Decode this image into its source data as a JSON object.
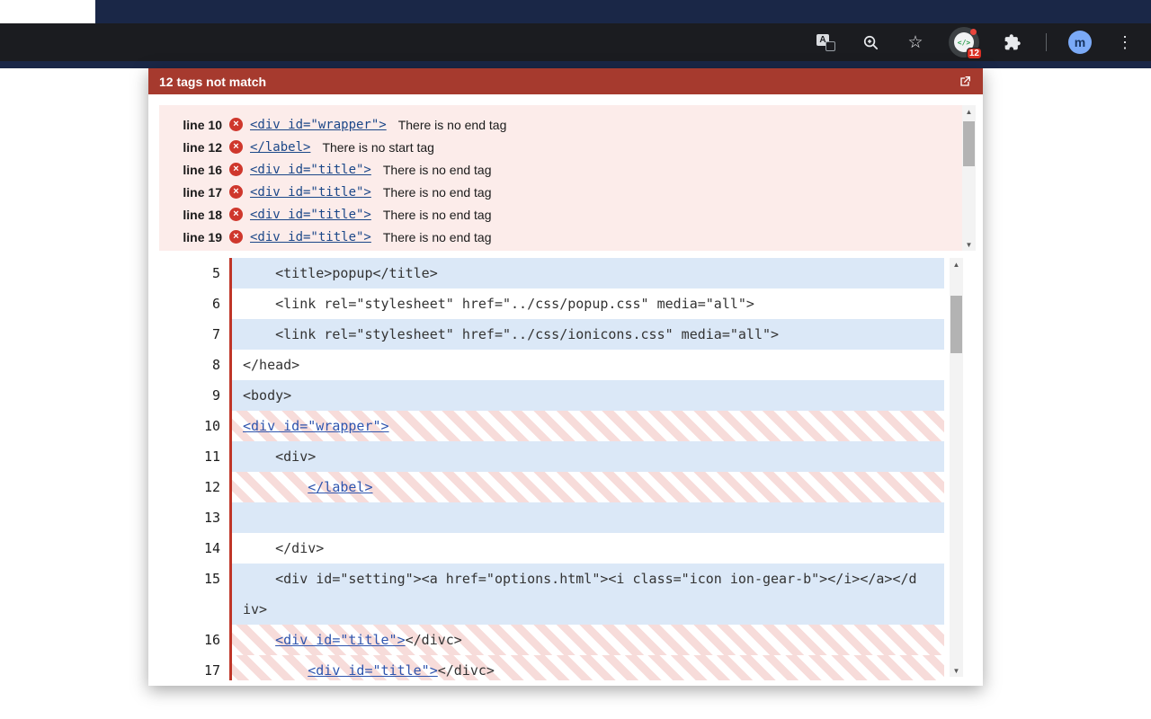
{
  "browser": {
    "avatar": "m",
    "extension_badge": "12",
    "extension_glyph": "</>",
    "translate_letter": "A",
    "star_glyph": "☆",
    "kebab_glyph": "⋮"
  },
  "popup": {
    "title": "12 tags not match",
    "errors": [
      {
        "line": "line 10",
        "tag": "<div id=\"wrapper\">",
        "message": "There is no end tag"
      },
      {
        "line": "line 12",
        "tag": "</label>",
        "message": "There is no start tag"
      },
      {
        "line": "line 16",
        "tag": "<div id=\"title\">",
        "message": "There is no end tag"
      },
      {
        "line": "line 17",
        "tag": "<div id=\"title\">",
        "message": "There is no end tag"
      },
      {
        "line": "line 18",
        "tag": "<div id=\"title\">",
        "message": "There is no end tag"
      },
      {
        "line": "line 19",
        "tag": "<div id=\"title\">",
        "message": "There is no end tag"
      }
    ],
    "code_lines": [
      {
        "num": "5",
        "bg": "blue",
        "segments": [
          {
            "text": "    <title>popup</title>"
          }
        ]
      },
      {
        "num": "6",
        "bg": "white",
        "segments": [
          {
            "text": "    <link rel=\"stylesheet\" href=\"../css/popup.css\" media=\"all\">"
          }
        ]
      },
      {
        "num": "7",
        "bg": "blue",
        "segments": [
          {
            "text": "    <link rel=\"stylesheet\" href=\"../css/ionicons.css\" media=\"all\">"
          }
        ]
      },
      {
        "num": "8",
        "bg": "white",
        "segments": [
          {
            "text": "</head>"
          }
        ]
      },
      {
        "num": "9",
        "bg": "blue",
        "segments": [
          {
            "text": "<body>"
          }
        ]
      },
      {
        "num": "10",
        "bg": "stripe",
        "segments": [
          {
            "text": "<div id=\"wrapper\">",
            "link": true
          }
        ]
      },
      {
        "num": "11",
        "bg": "blue",
        "segments": [
          {
            "text": "    <div>"
          }
        ]
      },
      {
        "num": "12",
        "bg": "stripe",
        "segments": [
          {
            "text": "        "
          },
          {
            "text": "</label>",
            "link": true
          }
        ]
      },
      {
        "num": "13",
        "bg": "blue",
        "segments": [
          {
            "text": ""
          }
        ]
      },
      {
        "num": "14",
        "bg": "white",
        "segments": [
          {
            "text": "    </div>"
          }
        ]
      },
      {
        "num": "15",
        "bg": "blue",
        "segments": [
          {
            "text": "    <div id=\"setting\"><a href=\"options.html\"><i class=\"icon ion-gear-b\"></i></a></div>"
          }
        ]
      },
      {
        "num": "16",
        "bg": "stripe",
        "segments": [
          {
            "text": "    "
          },
          {
            "text": "<div id=\"title\">",
            "link": true
          },
          {
            "text": "</divc>"
          }
        ]
      },
      {
        "num": "17",
        "bg": "stripe",
        "segments": [
          {
            "text": "        "
          },
          {
            "text": "<div id=\"title\">",
            "link": true
          },
          {
            "text": "</divc>"
          }
        ]
      }
    ]
  }
}
